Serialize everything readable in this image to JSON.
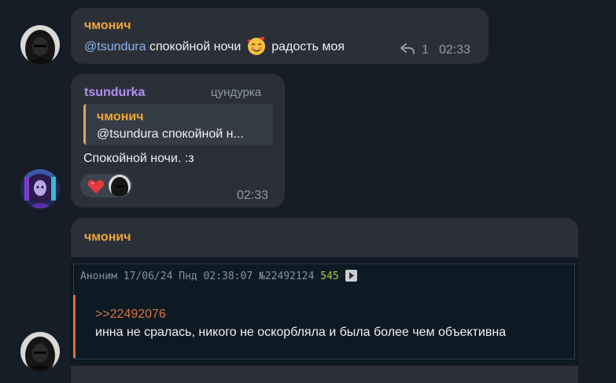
{
  "messages": [
    {
      "sender": "чмонич",
      "mention": "@tsundura",
      "text": "спокойной ночи",
      "text_after": "радость моя",
      "emoji": "smiling-face-with-hearts",
      "reply_count": "1",
      "time": "02:33"
    },
    {
      "sender": "tsundurka",
      "sender_alias": "цундурка",
      "reply_to": {
        "sender": "чмонич",
        "text": "@tsundura спокойной н..."
      },
      "text": "Спокойной ночи. :з",
      "reactions": [
        "heart",
        "avatar"
      ],
      "time": "02:33"
    },
    {
      "sender": "чмонич",
      "post": {
        "header_author": "Аноним",
        "header_date": "17/06/24 Пнд 02:38:07",
        "header_id": "№22492124",
        "header_count": "545",
        "quote_link": ">>22492076",
        "body": "инна не сралась, никого не оскорбляла и была более чем объективна"
      }
    }
  ],
  "colors": {
    "background": "#161d27",
    "bubble": "#2b3038",
    "sender_orange": "#f0a73a",
    "sender_purple": "#b48ef2",
    "mention_blue": "#8ab4ef",
    "embed_link": "#d9713c",
    "embed_count": "#9fcf4f"
  }
}
